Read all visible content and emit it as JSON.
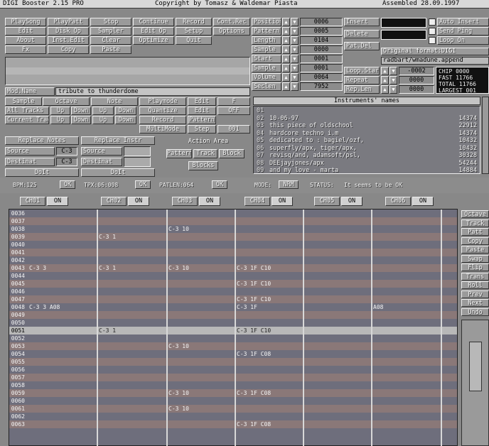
{
  "titlebar": {
    "app": "DIGI Booster 2.15 PRO",
    "copyright": "Copyright by Tomasz & Waldemar Piasta",
    "assembled": "Assembled 28.09.1997"
  },
  "top_buttons": [
    [
      "PlaySong",
      "PlayPatt",
      "Stop",
      "Continue",
      "Record",
      "Cont.Rec"
    ],
    [
      "Edit",
      "Disk Op",
      "Sampler",
      "Edit Op",
      "Setup",
      "Options"
    ],
    [
      "About",
      "Inst.Edit",
      "Clear",
      "Optimize",
      "Quit",
      ""
    ],
    [
      "Fx",
      "Copy",
      "Paste",
      "",
      "",
      ""
    ]
  ],
  "params_left": [
    {
      "label": "Position",
      "value": "0006"
    },
    {
      "label": "Pattern",
      "value": "0005"
    },
    {
      "label": "Length",
      "value": "0104"
    },
    {
      "label": "Sample",
      "value": "0000"
    },
    {
      "label": "Start",
      "value": "0001"
    },
    {
      "label": "Sample",
      "value": "0001"
    },
    {
      "label": "Volume",
      "value": "0064"
    },
    {
      "label": "Seclen",
      "value": "7952"
    }
  ],
  "params_right": [
    {
      "label": "Insert",
      "value": "0001"
    },
    {
      "label": "Delete",
      "value": "0000"
    },
    {
      "label": "Pat.Del",
      "value": "0000"
    }
  ],
  "checkboxes": [
    "Auto Insert",
    "Send Ping",
    "Loop On"
  ],
  "format_line": "Original format:DIGI",
  "module_line": "radbart/wmadune.append",
  "loop_rows": [
    {
      "label": "Loop.Start",
      "value": "-0002"
    },
    {
      "label": "Repeat",
      "value": "0000"
    },
    {
      "label": "Rep.Len",
      "value": "0000"
    }
  ],
  "memory": [
    "CHIP 0000",
    "FAST 11766",
    "TOTAL 11766",
    "LARGEST 001"
  ],
  "mod_name_label": "Mod.Name",
  "mod_name_value": "tribute to thunderdome",
  "edit_rows": [
    [
      "Sample",
      "Octave",
      "Note",
      "Playmode",
      "Edit",
      "F"
    ],
    [
      "All Tracks",
      "Up",
      "Down",
      "Up",
      "Down",
      "Quantize",
      "Edit",
      "OFF"
    ],
    [
      "Current Track",
      "Up",
      "Down",
      "Up",
      "Down",
      "Record",
      "Pattern"
    ],
    [
      "",
      "",
      "",
      "",
      "",
      "MultiMode",
      "Step",
      "001"
    ]
  ],
  "replace_notes": "Replace Notes",
  "replace_instr": "Replace Instr",
  "source_label": "Source",
  "source_val": "C-3",
  "source2_label": "Source",
  "dest_label": "Destinat",
  "dest_val": "C-3",
  "dest2_label": "Destinat",
  "doit_1": "DoIt",
  "doit_2": "DoIt",
  "action_title": "Action Area",
  "action_buttons": [
    "Pattern",
    "Track",
    "Block",
    "Blocks"
  ],
  "instruments_title": "Instruments' names",
  "instruments": [
    {
      "n": "01",
      "name": "",
      "size": ""
    },
    {
      "n": "02",
      "name": "10-06-97",
      "size": "14374"
    },
    {
      "n": "03",
      "name": "this piece of oldschool",
      "size": "22912"
    },
    {
      "n": "04",
      "name": "hardcore techno i.m",
      "size": "14374"
    },
    {
      "n": "05",
      "name": "dedicated to : bagiel/ozf,",
      "size": "10432"
    },
    {
      "n": "06",
      "name": "superfly/apx, tiger/apx,",
      "size": "10432"
    },
    {
      "n": "07",
      "name": "revisq/and, adamsoft/psl,",
      "size": "30328"
    },
    {
      "n": "08",
      "name": "DEEjayjones/apx",
      "size": "54244"
    },
    {
      "n": "09",
      "name": "and my love - marta",
      "size": "14884"
    }
  ],
  "status": {
    "bpm_label": "BPM:125",
    "bpm_ok": "OK",
    "tpx_label": "TPX:06:008",
    "tpx_ok": "OK",
    "patlen_label": "PATLEN:064",
    "patlen_ok": "OK",
    "mode_label": "MODE:",
    "mode_value": "NRM",
    "status_label": "STATUS:",
    "status_text": "It seems to be OK"
  },
  "channels": [
    {
      "label": "CH01",
      "state": "ON"
    },
    {
      "label": "CH02",
      "state": "ON"
    },
    {
      "label": "CH03",
      "state": "ON"
    },
    {
      "label": "CH04",
      "state": "ON"
    },
    {
      "label": "CH05",
      "state": "ON"
    },
    {
      "label": "CH06",
      "state": "ON"
    }
  ],
  "right_tools": [
    "Octave",
    "Track",
    "Patt",
    "Copy",
    "Paste",
    "Swap",
    "Flip",
    "Trans",
    "Roll",
    "Prev",
    "Next",
    "Undo"
  ],
  "pattern_top": [
    {
      "row": "0036",
      "cells": [
        "",
        "",
        "",
        "",
        "",
        ""
      ]
    },
    {
      "row": "0037",
      "cells": [
        "",
        "",
        "",
        "",
        "",
        ""
      ]
    },
    {
      "row": "0038",
      "cells": [
        "",
        "",
        "C-3 10",
        "",
        "",
        ""
      ]
    },
    {
      "row": "0039",
      "cells": [
        "",
        "C-3 1",
        "",
        "",
        "",
        ""
      ]
    },
    {
      "row": "0040",
      "cells": [
        "",
        "",
        "",
        "",
        "",
        ""
      ]
    },
    {
      "row": "0041",
      "cells": [
        "",
        "",
        "",
        "",
        "",
        ""
      ]
    },
    {
      "row": "0042",
      "cells": [
        "",
        "",
        "",
        "",
        "",
        ""
      ]
    },
    {
      "row": "0043",
      "cells": [
        "C-3 3",
        "C-3 1",
        "C-3 10",
        "C-3 1F C10",
        "",
        ""
      ]
    },
    {
      "row": "0044",
      "cells": [
        "",
        "",
        "",
        "",
        "",
        ""
      ]
    },
    {
      "row": "0045",
      "cells": [
        "",
        "",
        "",
        "C-3 1F C10",
        "",
        ""
      ]
    },
    {
      "row": "0046",
      "cells": [
        "",
        "",
        "",
        "",
        "",
        ""
      ]
    },
    {
      "row": "0047",
      "cells": [
        "",
        "",
        "",
        "C-3 1F C10",
        "",
        ""
      ]
    },
    {
      "row": "0048",
      "cells": [
        "C-3 3 A08",
        "",
        "",
        "C-3 1F",
        "",
        "A08"
      ]
    },
    {
      "row": "0049",
      "cells": [
        "",
        "",
        "",
        "",
        "",
        ""
      ]
    },
    {
      "row": "0050",
      "cells": [
        "",
        "",
        "",
        "",
        "",
        ""
      ]
    }
  ],
  "pattern_current": {
    "row": "0051",
    "cells": [
      "",
      "C-3 1",
      "",
      "C-3 1F C10",
      "",
      ""
    ]
  },
  "pattern_bottom": [
    {
      "row": "0052",
      "cells": [
        "",
        "",
        "",
        "",
        "",
        ""
      ]
    },
    {
      "row": "0053",
      "cells": [
        "",
        "",
        "C-3 10",
        "",
        "",
        ""
      ]
    },
    {
      "row": "0054",
      "cells": [
        "",
        "",
        "",
        "C-3 1F C08",
        "",
        ""
      ]
    },
    {
      "row": "0055",
      "cells": [
        "",
        "",
        "",
        "",
        "",
        ""
      ]
    },
    {
      "row": "0056",
      "cells": [
        "",
        "",
        "",
        "",
        "",
        ""
      ]
    },
    {
      "row": "0057",
      "cells": [
        "",
        "",
        "",
        "",
        "",
        ""
      ]
    },
    {
      "row": "0058",
      "cells": [
        "",
        "",
        "",
        "",
        "",
        ""
      ]
    },
    {
      "row": "0059",
      "cells": [
        "",
        "",
        "C-3 10",
        "C-3 1F C08",
        "",
        ""
      ]
    },
    {
      "row": "0060",
      "cells": [
        "",
        "",
        "",
        "",
        "",
        ""
      ]
    },
    {
      "row": "0061",
      "cells": [
        "",
        "",
        "C-3 10",
        "",
        "",
        ""
      ]
    },
    {
      "row": "0062",
      "cells": [
        "",
        "",
        "",
        "",
        "",
        ""
      ]
    },
    {
      "row": "0063",
      "cells": [
        "",
        "",
        "",
        "C-3 1F C08",
        "",
        ""
      ]
    }
  ],
  "colors": {
    "panel": "#9a9a9a",
    "stripe_a": "#6e6e7c",
    "stripe_b": "#8a7878",
    "current_row": "#b8b8b8"
  }
}
